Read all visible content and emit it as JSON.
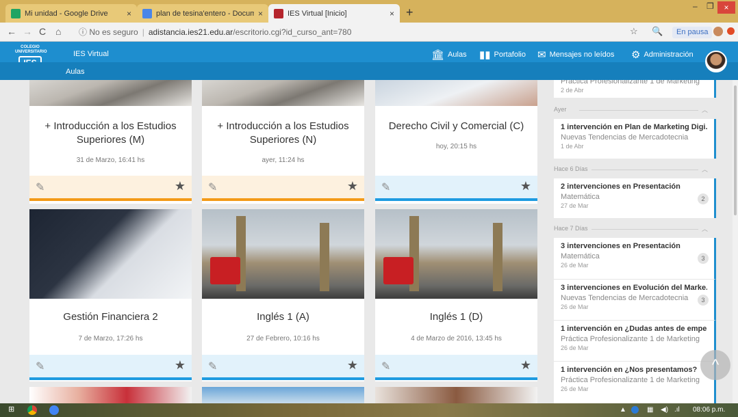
{
  "browser": {
    "tabs": [
      {
        "title": "Mi unidad - Google Drive",
        "close": "×",
        "color": "#1fa463"
      },
      {
        "title": "plan de tesina'entero - Documen",
        "close": "×",
        "color": "#4a86e8"
      },
      {
        "title": "IES Virtual [Inicio]",
        "close": "×",
        "color": "#b5242c"
      }
    ],
    "new_tab": "+",
    "win": {
      "min": "–",
      "max": "❐",
      "close": "×"
    },
    "nav": {
      "back": "←",
      "forward": "→",
      "reload": "C",
      "home": "⌂"
    },
    "security": "ⓘ No es seguro",
    "url_host": "adistancia.ies21.edu.ar",
    "url_path": "/escritorio.cgi?id_curso_ant=780",
    "pause": "En pausa"
  },
  "app": {
    "logo_line1": "COLEGIO",
    "logo_line2": "UNIVERSITARIO",
    "logo_mark": "IES",
    "name": "IES Virtual",
    "section": "Aulas",
    "menu": [
      {
        "icon": "columns-icon",
        "glyph": "🏛",
        "label": "Aulas"
      },
      {
        "icon": "portfolio-icon",
        "glyph": "▮▮",
        "label": "Portafolio"
      },
      {
        "icon": "mail-icon",
        "glyph": "✉",
        "label": "Mensajes no leídos"
      },
      {
        "icon": "gear-icon",
        "glyph": "⚙",
        "label": "Administración"
      }
    ]
  },
  "cards": [
    {
      "title": "+ Introducción a los Estudios Superiores (M)",
      "date": "31 de Marzo, 16:41 hs",
      "accent": "#f39a17",
      "foot_bg": "#fdf1df",
      "image": "laptop"
    },
    {
      "title": "+ Introducción a los Estudios Superiores (N)",
      "date": "ayer, 11:24 hs",
      "accent": "#f39a17",
      "foot_bg": "#fdf1df",
      "image": "laptop"
    },
    {
      "title": "Derecho Civil y Comercial (C)",
      "date": "hoy, 20:15 hs",
      "accent": "#1e9be0",
      "foot_bg": "#e2f2fb",
      "image": "pen"
    },
    {
      "title": "Gestión Financiera 2",
      "date": "7 de Marzo, 17:26 hs",
      "accent": "#1e9be0",
      "foot_bg": "#e2f2fb",
      "image": "hand"
    },
    {
      "title": "Inglés 1 (A)",
      "date": "27 de Febrero, 10:16 hs",
      "accent": "#1e9be0",
      "foot_bg": "#e2f2fb",
      "image": "london"
    },
    {
      "title": "Inglés 1 (D)",
      "date": "4 de Marzo de 2016, 13:45 hs",
      "accent": "#1e9be0",
      "foot_bg": "#e2f2fb",
      "image": "london"
    }
  ],
  "card_icons": {
    "edit": "✎",
    "star": "★"
  },
  "sidebar": {
    "top_item": {
      "course": "Práctica Profesionalizante 1 de Marketing",
      "date": "2 de Abr"
    },
    "groups": [
      {
        "label": "Ayer",
        "caret": "︿"
      },
      {
        "label": "Hace 6 Días",
        "caret": "︿"
      },
      {
        "label": "Hace 7 Días",
        "caret": "︿"
      }
    ],
    "items": [
      {
        "head": "1 intervención en Plan de Marketing Digi...",
        "course": "Nuevas Tendencias de Mercadotecnia",
        "date": "1 de Abr",
        "count": ""
      },
      {
        "head": "2 intervenciones en Presentación",
        "course": "Matemática",
        "date": "27 de Mar",
        "count": "2"
      },
      {
        "head": "3 intervenciones en Presentación",
        "course": "Matemática",
        "date": "26 de Mar",
        "count": "3"
      },
      {
        "head": "3 intervenciones en Evolución del Marke...",
        "course": "Nuevas Tendencias de Mercadotecnia",
        "date": "26 de Mar",
        "count": "3"
      },
      {
        "head": "1 intervención en ¿Dudas antes de empe...",
        "course": "Práctica Profesionalizante 1 de Marketing",
        "date": "26 de Mar",
        "count": ""
      },
      {
        "head": "1 intervención en ¿Nos presentamos?",
        "course": "Práctica Profesionalizante 1 de Marketing",
        "date": "26 de Mar",
        "count": ""
      }
    ],
    "scroll_top": "^"
  },
  "taskbar": {
    "time": "08:06 p.m.",
    "start": "⊞"
  }
}
